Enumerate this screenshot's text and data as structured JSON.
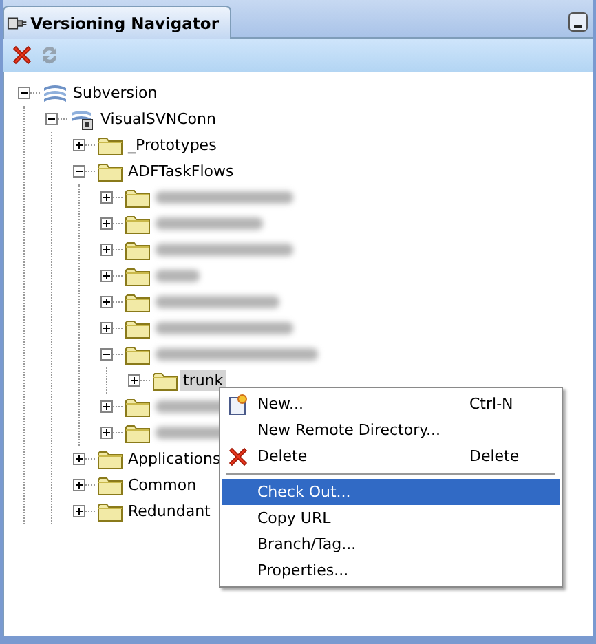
{
  "window": {
    "title": "Versioning Navigator"
  },
  "toolbar": [
    {
      "kind": "delete",
      "disabled": false
    },
    {
      "kind": "refresh",
      "disabled": true
    }
  ],
  "tree": [
    {
      "label": "Subversion",
      "kind": "repository",
      "expanded": true,
      "children": [
        {
          "label": "VisualSVNConn",
          "kind": "connection",
          "expanded": true,
          "children": [
            {
              "label": "_Prototypes",
              "kind": "folder",
              "expanded": false
            },
            {
              "label": "ADFTaskFlows",
              "kind": "folder",
              "expanded": true,
              "children": [
                {
                  "kind": "folder",
                  "redacted": true,
                  "expanded": false
                },
                {
                  "kind": "folder",
                  "redacted": true,
                  "expanded": false
                },
                {
                  "kind": "folder",
                  "redacted": true,
                  "expanded": false
                },
                {
                  "kind": "folder",
                  "redacted": true,
                  "expanded": false
                },
                {
                  "kind": "folder",
                  "redacted": true,
                  "expanded": false
                },
                {
                  "kind": "folder",
                  "redacted": true,
                  "expanded": false
                },
                {
                  "kind": "folder",
                  "redacted": true,
                  "expanded": true,
                  "children": [
                    {
                      "label": "trunk",
                      "kind": "folder",
                      "expanded": false,
                      "selected": true
                    }
                  ]
                },
                {
                  "kind": "folder",
                  "redacted": true,
                  "expanded": false
                },
                {
                  "kind": "folder",
                  "redacted": true,
                  "expanded": false
                }
              ]
            },
            {
              "label": "Applications",
              "kind": "folder",
              "expanded": false
            },
            {
              "label": "Common",
              "kind": "folder",
              "expanded": false
            },
            {
              "label": "Redundant",
              "kind": "folder",
              "expanded": false
            }
          ]
        }
      ]
    }
  ],
  "context_menu": [
    {
      "kind": "new",
      "label": "New...",
      "shortcut": "Ctrl-N",
      "selected": false
    },
    {
      "kind": "plain",
      "label": "New Remote Directory...",
      "selected": false
    },
    {
      "kind": "delete",
      "label": "Delete",
      "shortcut": "Delete",
      "selected": false
    },
    {
      "kind": "separator"
    },
    {
      "kind": "plain",
      "label": "Check Out...",
      "selected": true
    },
    {
      "kind": "plain",
      "label": "Copy URL",
      "selected": false
    },
    {
      "kind": "plain",
      "label": "Branch/Tag...",
      "selected": false
    },
    {
      "kind": "plain",
      "label": "Properties...",
      "selected": false
    }
  ]
}
